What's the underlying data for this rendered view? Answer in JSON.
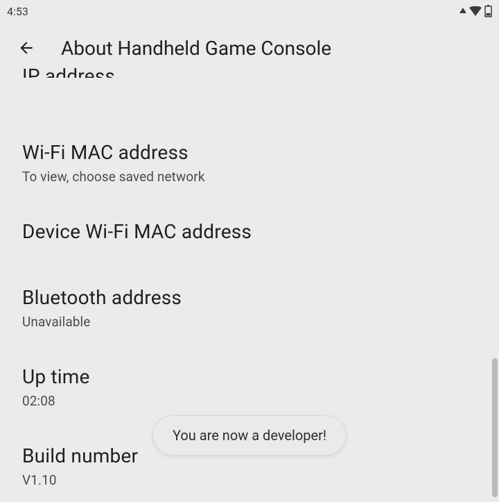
{
  "status": {
    "time": "4:53"
  },
  "header": {
    "title": "About Handheld Game Console"
  },
  "cutoff_item": {
    "title": "IP address"
  },
  "items": {
    "wifi_mac": {
      "title": "Wi-Fi MAC address",
      "sub": "To view, choose saved network"
    },
    "device_wifi_mac": {
      "title": "Device Wi-Fi MAC address"
    },
    "bluetooth": {
      "title": "Bluetooth address",
      "sub": "Unavailable"
    },
    "uptime": {
      "title": "Up time",
      "sub": "02:08"
    },
    "build": {
      "title": "Build number",
      "sub": "V1.10"
    }
  },
  "toast": {
    "message": "You are now a developer!"
  }
}
